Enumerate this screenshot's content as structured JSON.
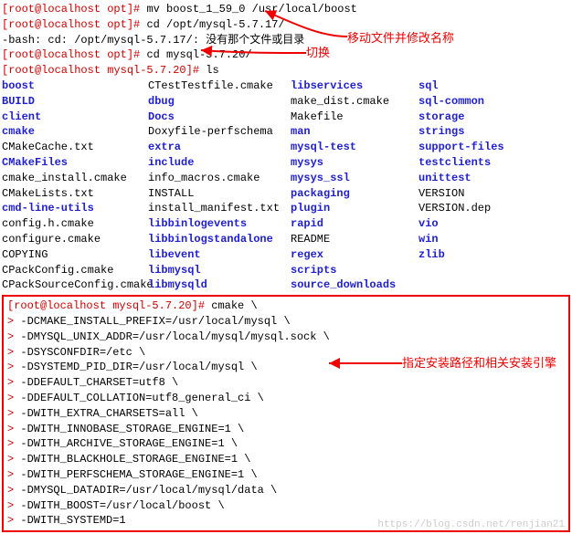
{
  "lines": {
    "l1_prompt": "[root@localhost opt]#",
    "l1_cmd": "mv boost_1_59_0 /usr/local/boost",
    "l2_prompt": "[root@localhost opt]#",
    "l2_cmd": "cd /opt/mysql-5.7.17/",
    "l3": "-bash: cd: /opt/mysql-5.7.17/: 没有那个文件或目录",
    "l4_prompt": "[root@localhost opt]#",
    "l4_cmd": "cd mysql-5.7.20/",
    "l5_prompt": "[root@localhost mysql-5.7.20]#",
    "l5_cmd": "ls"
  },
  "annotations": {
    "a1": "移动文件并修改名称",
    "a2": "切换",
    "a3": "指定安装路径和相关安装引擎"
  },
  "ls": [
    [
      "boost",
      "d",
      "CTestTestfile.cmake",
      "f",
      "libservices",
      "d",
      "sql",
      "d"
    ],
    [
      "BUILD",
      "d",
      "dbug",
      "d",
      "make_dist.cmake",
      "f",
      "sql-common",
      "d"
    ],
    [
      "client",
      "d",
      "Docs",
      "d",
      "Makefile",
      "f",
      "storage",
      "d"
    ],
    [
      "cmake",
      "d",
      "Doxyfile-perfschema",
      "f",
      "man",
      "d",
      "strings",
      "d"
    ],
    [
      "CMakeCache.txt",
      "f",
      "extra",
      "d",
      "mysql-test",
      "d",
      "support-files",
      "d"
    ],
    [
      "CMakeFiles",
      "d",
      "include",
      "d",
      "mysys",
      "d",
      "testclients",
      "d"
    ],
    [
      "cmake_install.cmake",
      "f",
      "info_macros.cmake",
      "f",
      "mysys_ssl",
      "d",
      "unittest",
      "d"
    ],
    [
      "CMakeLists.txt",
      "f",
      "INSTALL",
      "f",
      "packaging",
      "d",
      "VERSION",
      "f"
    ],
    [
      "cmd-line-utils",
      "d",
      "install_manifest.txt",
      "f",
      "plugin",
      "d",
      "VERSION.dep",
      "f"
    ],
    [
      "config.h.cmake",
      "f",
      "libbinlogevents",
      "d",
      "rapid",
      "d",
      "vio",
      "d"
    ],
    [
      "configure.cmake",
      "f",
      "libbinlogstandalone",
      "d",
      "README",
      "f",
      "win",
      "d"
    ],
    [
      "COPYING",
      "f",
      "libevent",
      "d",
      "regex",
      "d",
      "zlib",
      "d"
    ],
    [
      "CPackConfig.cmake",
      "f",
      "libmysql",
      "d",
      "scripts",
      "d",
      "",
      "f"
    ],
    [
      "CPackSourceConfig.cmake",
      "f",
      "libmysqld",
      "d",
      "source_downloads",
      "d",
      "",
      "f"
    ]
  ],
  "cmake": {
    "prompt": "[root@localhost mysql-5.7.20]#",
    "head": "cmake \\",
    "opts": [
      "-DCMAKE_INSTALL_PREFIX=/usr/local/mysql \\",
      "-DMYSQL_UNIX_ADDR=/usr/local/mysql/mysql.sock \\",
      "-DSYSCONFDIR=/etc \\",
      "-DSYSTEMD_PID_DIR=/usr/local/mysql \\",
      "-DDEFAULT_CHARSET=utf8 \\",
      "-DDEFAULT_COLLATION=utf8_general_ci \\",
      "-DWITH_EXTRA_CHARSETS=all \\",
      "-DWITH_INNOBASE_STORAGE_ENGINE=1 \\",
      "-DWITH_ARCHIVE_STORAGE_ENGINE=1 \\",
      "-DWITH_BLACKHOLE_STORAGE_ENGINE=1 \\",
      "-DWITH_PERFSCHEMA_STORAGE_ENGINE=1 \\",
      "-DMYSQL_DATADIR=/usr/local/mysql/data \\",
      "-DWITH_BOOST=/usr/local/boost \\",
      "-DWITH_SYSTEMD=1"
    ]
  },
  "watermark": "https://blog.csdn.net/renjian21"
}
